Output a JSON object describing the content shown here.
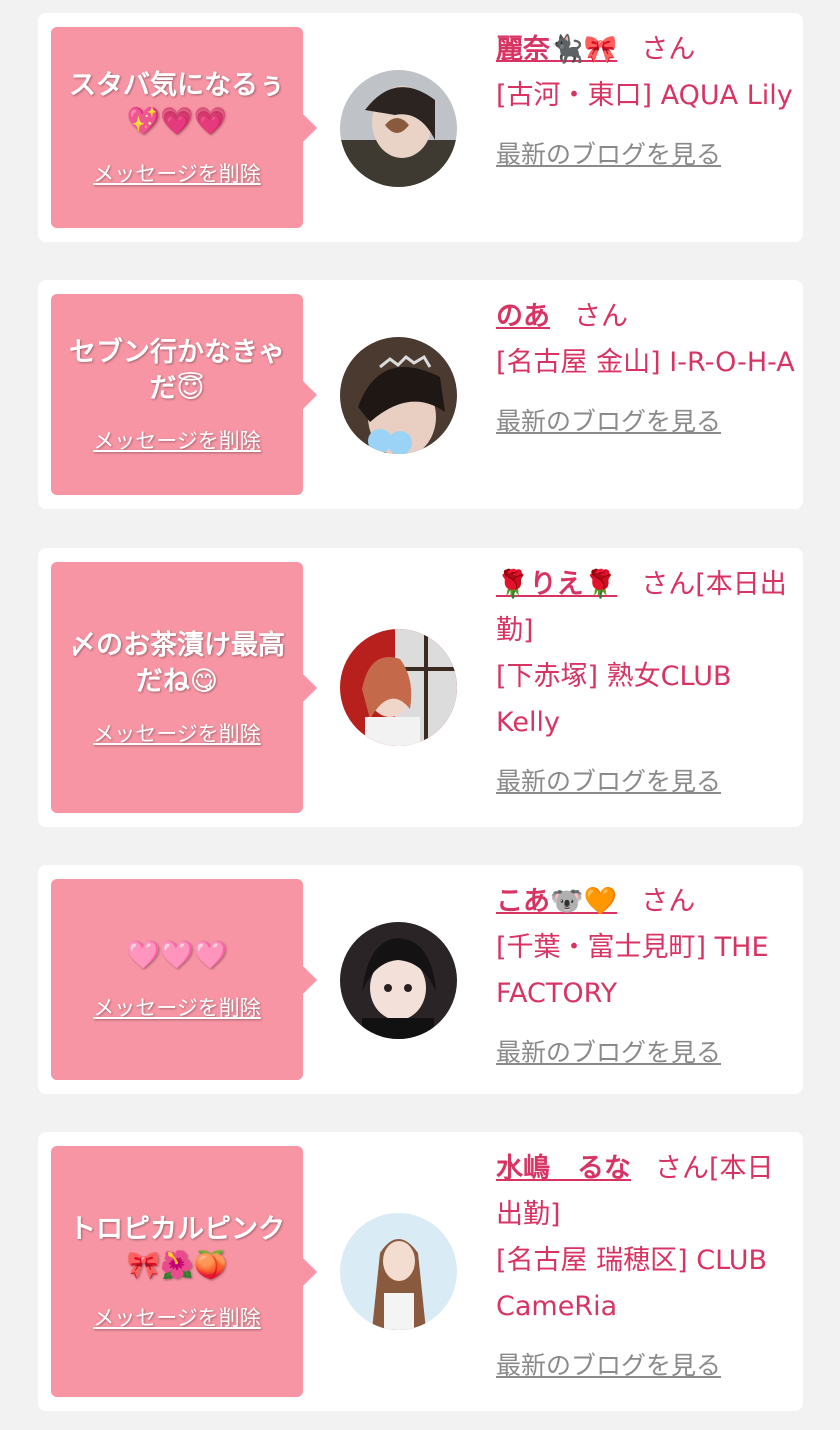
{
  "delete_label": "メッセージを削除",
  "blog_label": "最新のブログを見る",
  "colors": {
    "accent": "#d83463",
    "bubble": "#f795a4",
    "background": "#f2f2f2",
    "link_gray": "#8a8a8a"
  },
  "messages": [
    {
      "text": "スタバ気になるぅ💖💗💗",
      "name": "麗奈🐈‍⬛🎀",
      "san": "さん",
      "shop": "[古河・東口] AQUA Lily",
      "avatar_icon": "avatar-photo"
    },
    {
      "text": "セブン行かなきゃだ😇",
      "name": "のあ",
      "san": "さん",
      "shop": "[名古屋 金山] I-R-O-H-A",
      "avatar_icon": "avatar-photo"
    },
    {
      "text": "〆のお茶漬け最高だね😋",
      "name": "🌹りえ🌹",
      "san": "さん[本日出勤]",
      "shop": "[下赤塚] 熟女CLUB Kelly",
      "avatar_icon": "avatar-photo"
    },
    {
      "text": "🩷🩷🩷",
      "name": "こあ🐨🧡",
      "san": "さん",
      "shop": "[千葉・富士見町] THE FACTORY",
      "avatar_icon": "avatar-photo"
    },
    {
      "text": "トロピカルピンク🎀🌺🍑",
      "name": "水嶋　るな",
      "san": "さん[本日出勤]",
      "shop": "[名古屋 瑞穂区] CLUB CameRia",
      "avatar_icon": "avatar-photo"
    }
  ]
}
